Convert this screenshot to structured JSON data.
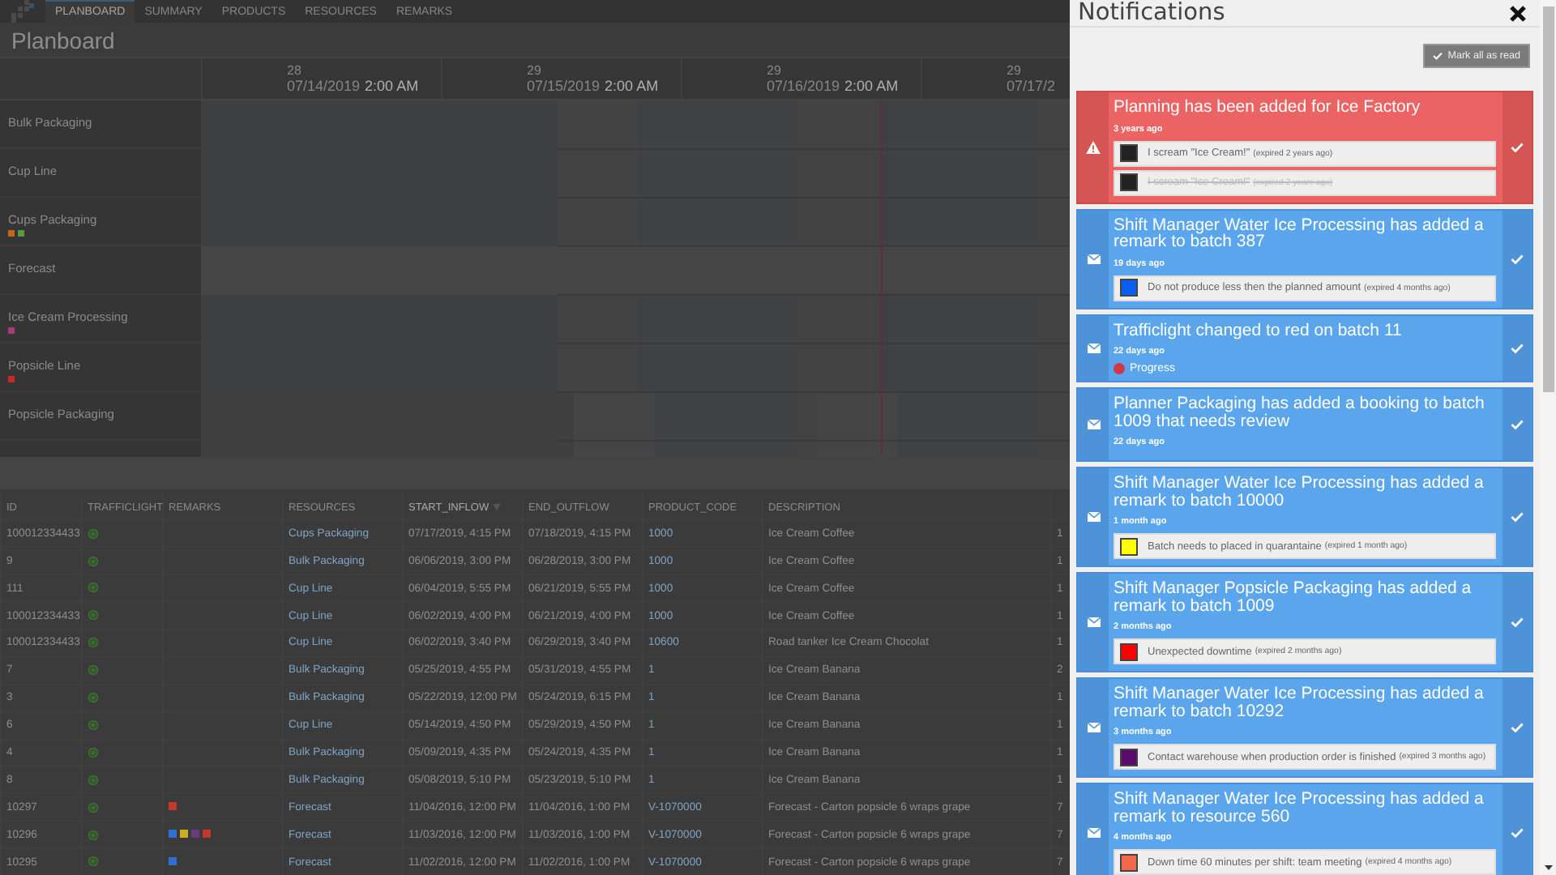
{
  "nav": {
    "tabs": [
      {
        "label": "PLANBOARD",
        "selected": true
      },
      {
        "label": "SUMMARY",
        "selected": false
      },
      {
        "label": "PRODUCTS",
        "selected": false
      },
      {
        "label": "RESOURCES",
        "selected": false
      },
      {
        "label": "REMARKS",
        "selected": false
      }
    ]
  },
  "page_title": "Planboard",
  "timeline": {
    "columns": [
      {
        "day": "28",
        "date": "07/14/2019",
        "time": "2:00 AM"
      },
      {
        "day": "29",
        "date": "07/15/2019",
        "time": "2:00 AM"
      },
      {
        "day": "29",
        "date": "07/16/2019",
        "time": "2:00 AM"
      },
      {
        "day": "29",
        "date": "07/17/2"
      }
    ]
  },
  "resources": [
    {
      "name": "Bulk Packaging"
    },
    {
      "name": "Cup Line"
    },
    {
      "name": "Cups Packaging",
      "markers": [
        {
          "color": "#c86420"
        },
        {
          "color": "#5a9a3a"
        }
      ]
    },
    {
      "name": "Forecast"
    },
    {
      "name": "Ice Cream Processing",
      "markers": [
        {
          "color": "#a03c78"
        }
      ]
    },
    {
      "name": "Popsicle Line",
      "markers": [
        {
          "color": "#c82828"
        }
      ]
    },
    {
      "name": "Popsicle Packaging"
    }
  ],
  "table": {
    "columns": [
      {
        "label": "ID",
        "sorted": false
      },
      {
        "label": "TRAFFICLIGHT",
        "sorted": false
      },
      {
        "label": "REMARKS",
        "sorted": false
      },
      {
        "label": "RESOURCES",
        "sorted": false
      },
      {
        "label": "START_INFLOW",
        "sorted": true
      },
      {
        "label": "END_OUTFLOW",
        "sorted": false
      },
      {
        "label": "PRODUCT_CODE",
        "sorted": false
      },
      {
        "label": "DESCRIPTION",
        "sorted": false
      }
    ],
    "rows": [
      {
        "id": "100012334433",
        "remarks": [],
        "resource": "Cups Packaging",
        "start": "07/17/2019, 4:15 PM",
        "end": "07/18/2019, 4:15 PM",
        "product_code": "1000",
        "description": "Ice Cream Coffee",
        "column_9": "1"
      },
      {
        "id": "9",
        "remarks": [],
        "resource": "Bulk Packaging",
        "start": "06/06/2019, 3:00 PM",
        "end": "06/28/2019, 3:00 PM",
        "product_code": "1000",
        "description": "Ice Cream Coffee",
        "column_9": "1"
      },
      {
        "id": "111",
        "remarks": [],
        "resource": "Cup Line",
        "start": "06/04/2019, 5:55 PM",
        "end": "06/21/2019, 5:55 PM",
        "product_code": "1000",
        "description": "Ice Cream Coffee",
        "column_9": "1"
      },
      {
        "id": "100012334433",
        "remarks": [],
        "resource": "Cup Line",
        "start": "06/02/2019, 4:00 PM",
        "end": "06/21/2019, 4:00 PM",
        "product_code": "1000",
        "description": "Ice Cream Coffee",
        "column_9": "1"
      },
      {
        "id": "100012334433",
        "remarks": [],
        "resource": "Cup Line",
        "start": "06/02/2019, 3:40 PM",
        "end": "06/29/2019, 3:40 PM",
        "product_code": "10600",
        "description": "Road tanker Ice Cream Chocolat",
        "column_9": "1"
      },
      {
        "id": "7",
        "remarks": [],
        "resource": "Bulk Packaging",
        "start": "05/25/2019, 4:55 PM",
        "end": "05/31/2019, 4:55 PM",
        "product_code": "1",
        "description": "Ice Cream Banana",
        "column_9": "2"
      },
      {
        "id": "3",
        "remarks": [],
        "resource": "Bulk Packaging",
        "start": "05/22/2019, 12:00 PM",
        "end": "05/24/2019, 6:15 PM",
        "product_code": "1",
        "description": "Ice Cream Banana",
        "column_9": "1"
      },
      {
        "id": "6",
        "remarks": [],
        "resource": "Cup Line",
        "start": "05/14/2019, 4:50 PM",
        "end": "05/29/2019, 4:50 PM",
        "product_code": "1",
        "description": "Ice Cream Banana",
        "column_9": "1"
      },
      {
        "id": "4",
        "remarks": [],
        "resource": "Bulk Packaging",
        "start": "05/09/2019, 4:35 PM",
        "end": "05/24/2019, 4:35 PM",
        "product_code": "1",
        "description": "Ice Cream Banana",
        "column_9": "1"
      },
      {
        "id": "8",
        "remarks": [],
        "resource": "Bulk Packaging",
        "start": "05/08/2019, 5:10 PM",
        "end": "05/23/2019, 5:10 PM",
        "product_code": "1",
        "description": "Ice Cream Banana",
        "column_9": "1"
      },
      {
        "id": "10297",
        "remarks": [
          {
            "color": "#c0392b"
          }
        ],
        "resource": "Forecast",
        "start": "11/04/2016, 12:00 PM",
        "end": "11/04/2016, 1:00 PM",
        "product_code": "V-1070000",
        "description": "Forecast - Carton popsicle 6 wraps grape",
        "column_9": "7"
      },
      {
        "id": "10296",
        "remarks": [
          {
            "color": "#2e6fd0"
          },
          {
            "color": "#c8b020"
          },
          {
            "color": "#6a3a80"
          },
          {
            "color": "#c0392b"
          }
        ],
        "resource": "Forecast",
        "start": "11/03/2016, 12:00 PM",
        "end": "11/03/2016, 1:00 PM",
        "product_code": "V-1070000",
        "description": "Forecast - Carton popsicle 6 wraps grape",
        "column_9": "7"
      },
      {
        "id": "10295",
        "remarks": [
          {
            "color": "#2e6fd0"
          }
        ],
        "resource": "Forecast",
        "start": "11/02/2016, 12:00 PM",
        "end": "11/02/2016, 1:00 PM",
        "product_code": "V-1070000",
        "description": "Forecast - Carton popsicle 6 wraps grape",
        "column_9": "7"
      }
    ]
  },
  "notifications": {
    "title": "Notifications",
    "mark_all_button": "Mark all as read",
    "items": [
      {
        "kind": "warning",
        "title": "Planning has been added for Ice Factory",
        "time": "3 years ago",
        "remarks": [
          {
            "text": "I scream \"Ice Cream!\"",
            "expiry": "(expired 2 years ago)",
            "color": "#222222",
            "struck": false
          },
          {
            "text": "I scream \"Ice Cream!\"",
            "expiry": "(expired 2 years ago)",
            "color": "#222222",
            "struck": true
          }
        ]
      },
      {
        "kind": "message",
        "title": "Shift Manager Water Ice Processing has added a remark to batch 387",
        "time": "19 days ago",
        "remarks": [
          {
            "text": "Do not produce less then the planned amount",
            "expiry": "(expired 4 months ago)",
            "color": "#0a5ff0",
            "struck": false
          }
        ]
      },
      {
        "kind": "message",
        "title": "Trafficlight changed to red on batch 11",
        "time": "22 days ago",
        "status": {
          "label": "Progress",
          "color": "#d0384a"
        }
      },
      {
        "kind": "message",
        "title": "Planner Packaging has added a booking to batch 1009 that needs review",
        "time": "22 days ago"
      },
      {
        "kind": "message",
        "title": "Shift Manager Water Ice Processing has added a remark to batch 10000",
        "time": "1 month ago",
        "remarks": [
          {
            "text": "Batch needs to placed in quarantaine",
            "expiry": "(expired 1 month ago)",
            "color": "#ffff00",
            "struck": false
          }
        ]
      },
      {
        "kind": "message",
        "title": "Shift Manager Popsicle Packaging has added a remark to batch 1009",
        "time": "2 months ago",
        "remarks": [
          {
            "text": "Unexpected downtime",
            "expiry": "(expired 2 months ago)",
            "color": "#ff0000",
            "struck": false
          }
        ]
      },
      {
        "kind": "message",
        "title": "Shift Manager Water Ice Processing has added a remark to batch 10292",
        "time": "3 months ago",
        "remarks": [
          {
            "text": "Contact warehouse when production order is finished",
            "expiry": "(expired 3 months ago)",
            "color": "#5a0a6a",
            "struck": false
          }
        ]
      },
      {
        "kind": "message",
        "title": "Shift Manager Water Ice Processing has added a remark to resource 560",
        "time": "4 months ago",
        "remarks": [
          {
            "text": "Down time 60 minutes per shift: team meeting",
            "expiry": "(expired 4 months ago)",
            "color": "#f06a4a",
            "struck": false
          }
        ]
      }
    ]
  }
}
